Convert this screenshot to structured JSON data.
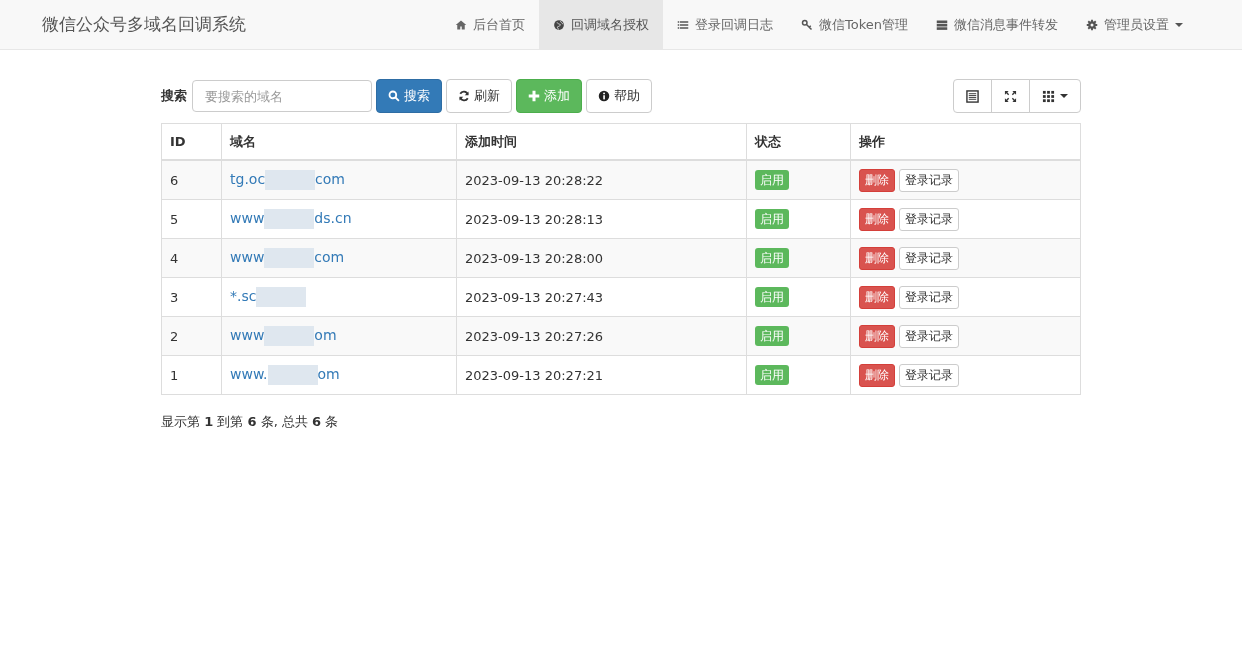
{
  "navbar": {
    "brand": "微信公众号多域名回调系统",
    "items": [
      {
        "label": "后台首页",
        "selected": false
      },
      {
        "label": "回调域名授权",
        "selected": true
      },
      {
        "label": "登录回调日志",
        "selected": false
      },
      {
        "label": "微信Token管理",
        "selected": false
      },
      {
        "label": "微信消息事件转发",
        "selected": false
      },
      {
        "label": "管理员设置",
        "selected": false,
        "dropdown": true
      }
    ]
  },
  "toolbar": {
    "search_label": "搜索",
    "search_placeholder": "要搜索的域名",
    "buttons": [
      {
        "kind": "primary",
        "label": "搜索"
      },
      {
        "kind": "default",
        "label": "刷新"
      },
      {
        "kind": "success",
        "label": "添加"
      },
      {
        "kind": "default",
        "label": "帮助"
      }
    ]
  },
  "table": {
    "columns": [
      "ID",
      "域名",
      "添加时间",
      "状态",
      "操作"
    ],
    "rows": [
      {
        "id": "6",
        "domain_head": "tg.oc",
        "domain_tail": "com",
        "time": "2023-09-13 20:28:22",
        "status": "启用",
        "actions": [
          "删除",
          "登录记录"
        ]
      },
      {
        "id": "5",
        "domain_head": "www",
        "domain_tail": "ds.cn",
        "time": "2023-09-13 20:28:13",
        "status": "启用",
        "actions": [
          "删除",
          "登录记录"
        ]
      },
      {
        "id": "4",
        "domain_head": "www",
        "domain_tail": "com",
        "time": "2023-09-13 20:28:00",
        "status": "启用",
        "actions": [
          "删除",
          "登录记录"
        ]
      },
      {
        "id": "3",
        "domain_head": "*.sc",
        "time": "2023-09-13 20:27:43",
        "status": "启用",
        "actions": [
          "删除",
          "登录记录"
        ]
      },
      {
        "id": "2",
        "domain_head": "www",
        "domain_tail": "om",
        "time": "2023-09-13 20:27:26",
        "status": "启用",
        "actions": [
          "删除",
          "登录记录"
        ]
      },
      {
        "id": "1",
        "domain_head": "www.",
        "domain_tail": "om",
        "time": "2023-09-13 20:27:21",
        "status": "启用",
        "actions": [
          "删除",
          "登录记录"
        ]
      }
    ]
  },
  "pagination_info": "显示第 **1** 到第 **6** 条, 总共 **6** 条"
}
